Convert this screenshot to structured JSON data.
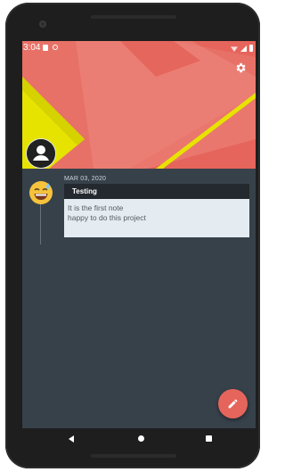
{
  "statusbar": {
    "time": "3:04"
  },
  "header": {
    "settings_icon": "gear-icon",
    "profile_icon": "person-icon"
  },
  "note": {
    "date": "MAR 03, 2020",
    "title": "Testing",
    "body_line1": "It is the first note",
    "body_line2": "happy to do this project",
    "avatar_icon": "smiling-sweat-emoji-icon"
  },
  "fab": {
    "icon": "pencil-icon"
  },
  "navigation": {
    "back_icon": "back-triangle-icon",
    "home_icon": "home-circle-icon",
    "recents_icon": "recents-square-icon"
  },
  "colors": {
    "header_background": "#e5655c",
    "accent_yellow": "#e7e300",
    "screen_background": "#37414a",
    "note_title_bar": "#23292e",
    "note_body": "#e4ecf1"
  }
}
